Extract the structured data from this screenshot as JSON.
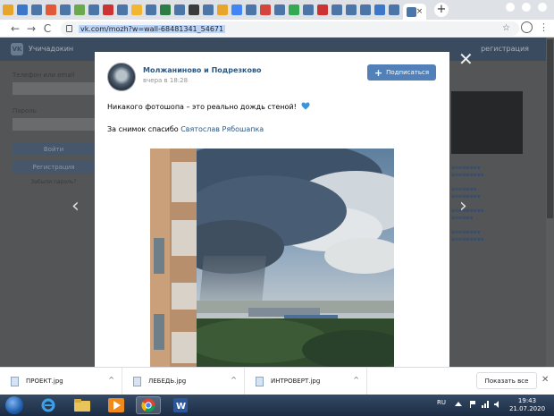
{
  "browser": {
    "url_display": "vk.com/mozh?w=wall-68481341_54671",
    "tab_count_label": "many pinned tabs",
    "tab_close": "×",
    "new_tab": "+",
    "nav_back": "←",
    "nav_forward": "→",
    "nav_reload": "C",
    "bookmark_star": "☆",
    "menu_kebab": "⋮"
  },
  "vk_page": {
    "logo": "VK",
    "login_label": "Телефон или email",
    "password_label": "Пароль",
    "login_button": "Войти",
    "register_button": "Регистрация",
    "forgot_link": "Забыли пароль?"
  },
  "overlay": {
    "close": "✕",
    "prev_arrow": "‹",
    "next_arrow": "›"
  },
  "post": {
    "group_name": "Молжаниново и Подрезково",
    "time": "вчера в 18:28",
    "subscribe_label": "Подписаться",
    "subscribe_icon": "+",
    "text": "Никакого фотошопа – это реально дождь стеной!",
    "thanks_prefix": "За снимок спасибо ",
    "thanks_person": "Святослав Рябошапка",
    "heart_icon": "blue-heart"
  },
  "downloads": {
    "items": [
      {
        "name": "ПРОЕКТ.jpg",
        "chevron": "^"
      },
      {
        "name": "ЛЕБЕДЬ.jpg",
        "chevron": "^"
      },
      {
        "name": "ИНТРОВЕРТ.jpg",
        "chevron": "^"
      }
    ],
    "show_all": "Показать все",
    "close": "✕"
  },
  "taskbar": {
    "lang": "RU",
    "time": "19:43",
    "date": "21.07.2020"
  },
  "colors": {
    "vk_blue": "#5181b8",
    "link": "#2a5885",
    "overlay_dim": "#545556"
  }
}
